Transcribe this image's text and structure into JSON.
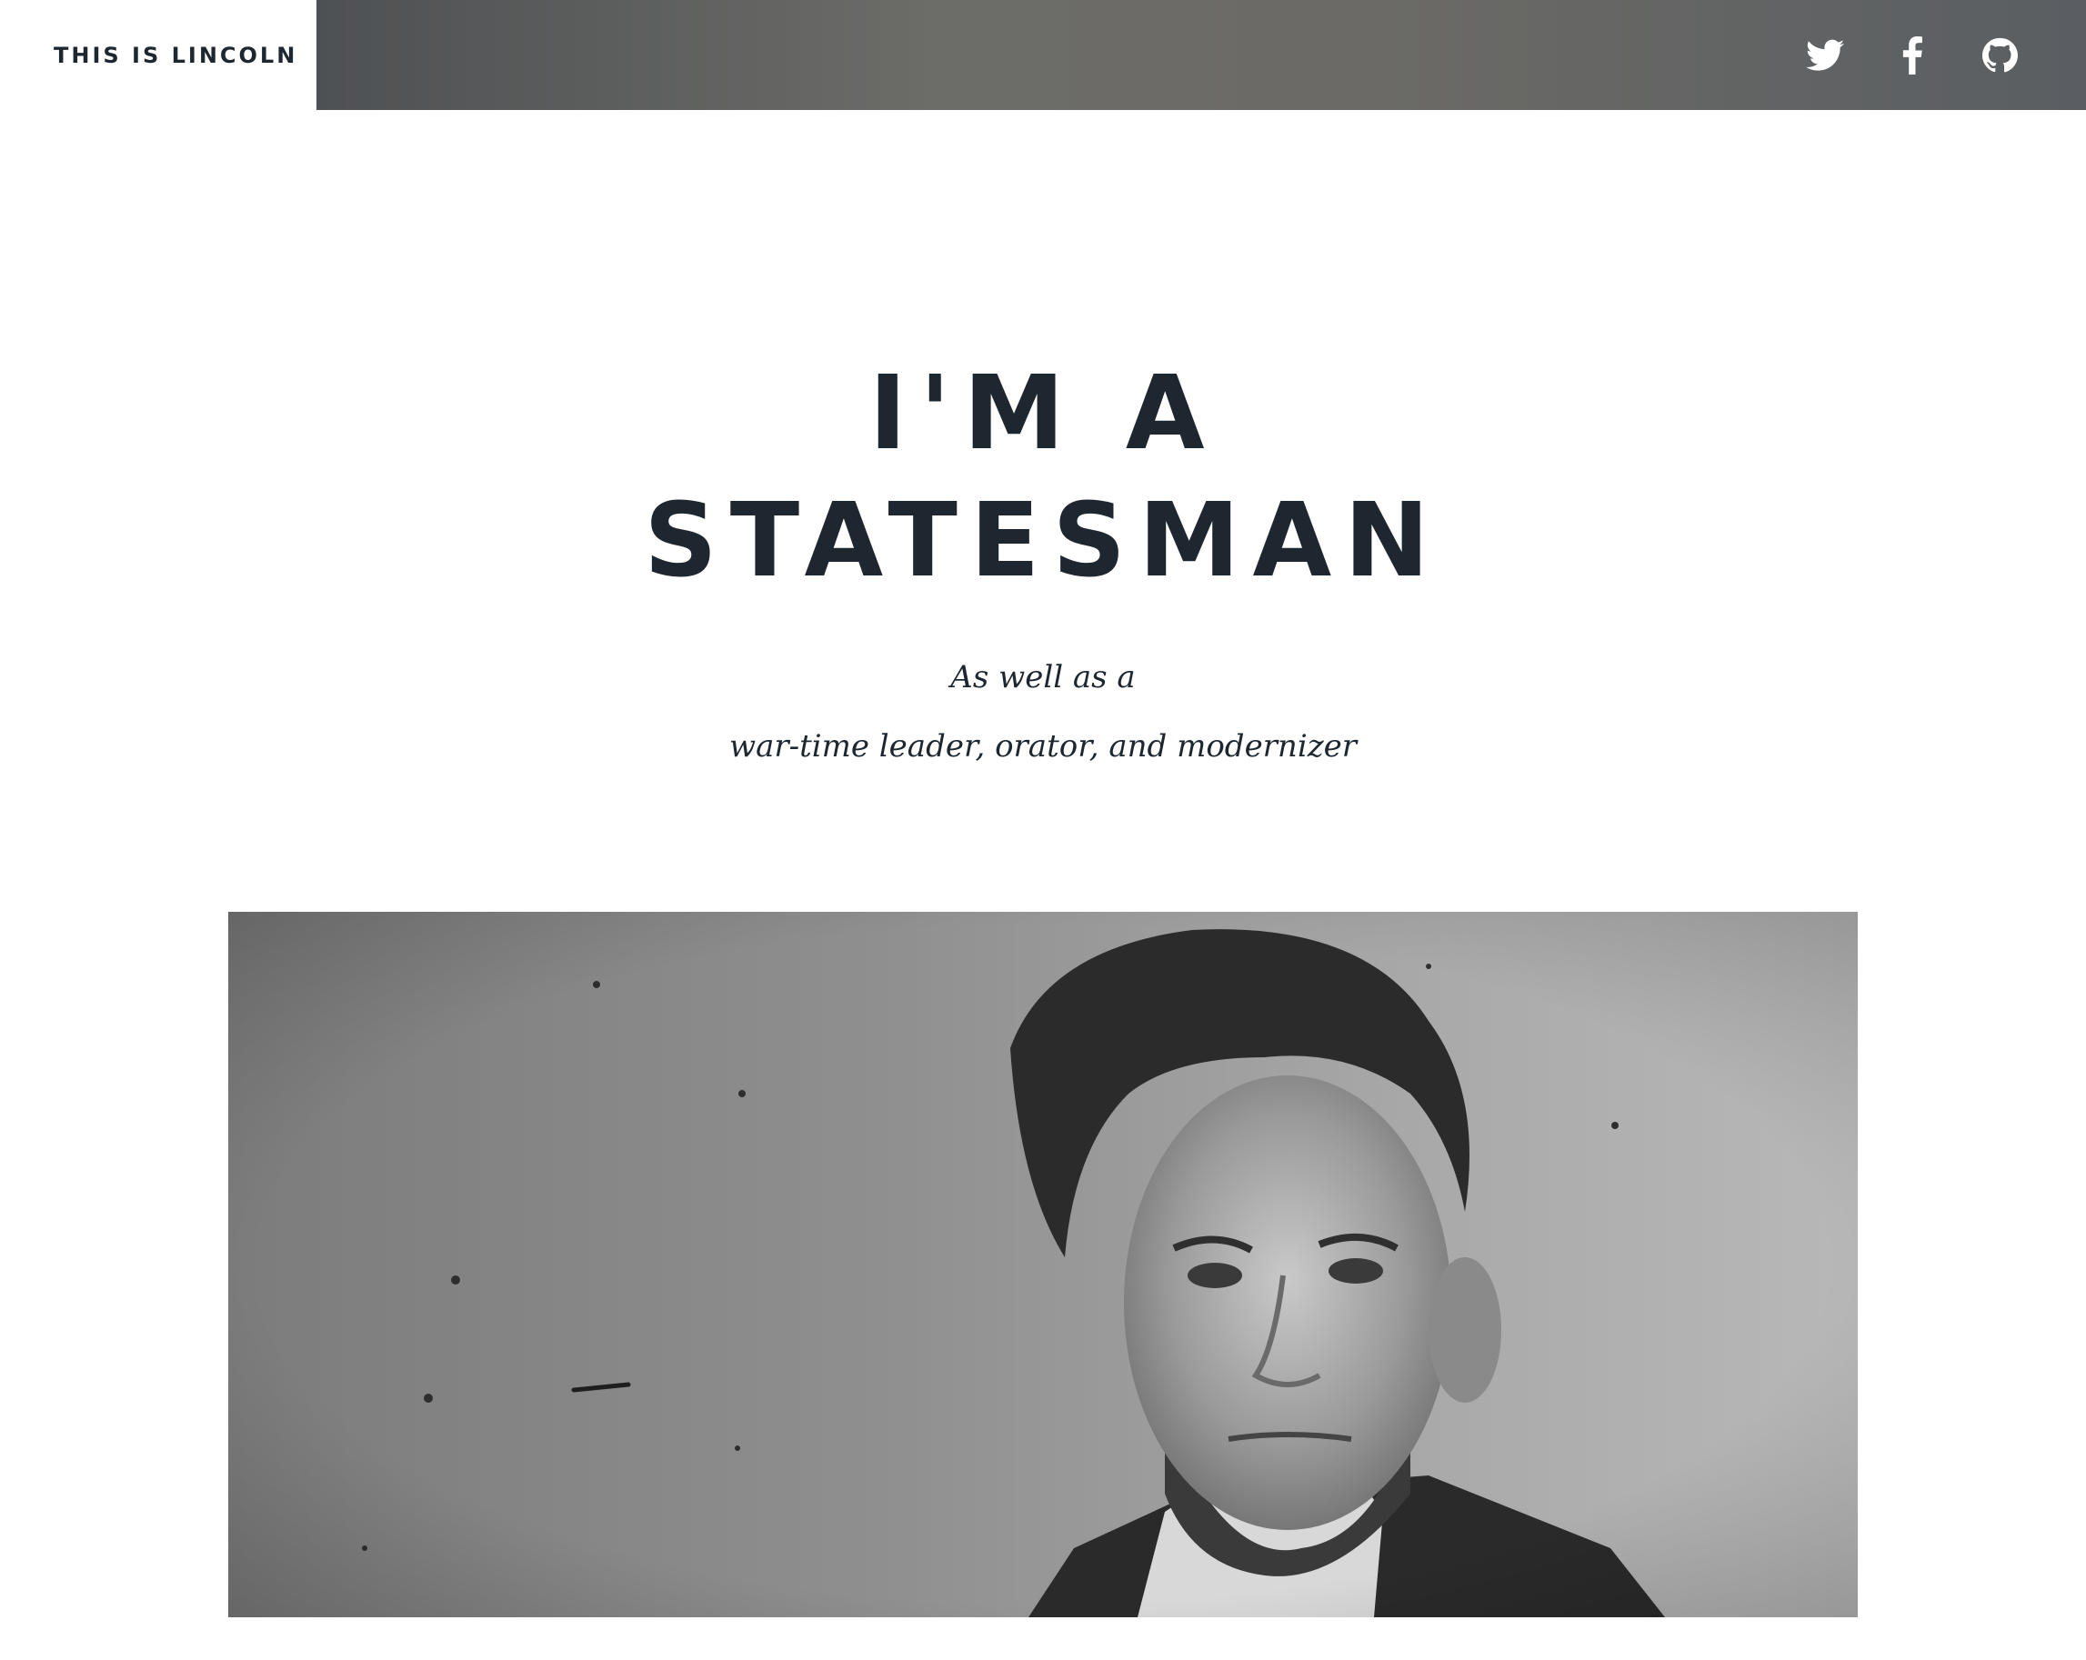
{
  "header": {
    "brand": "THIS IS LINCOLN",
    "social": [
      {
        "icon": "twitter-icon"
      },
      {
        "icon": "facebook-icon"
      },
      {
        "icon": "github-icon"
      }
    ]
  },
  "hero": {
    "headline_line1": "I'M A",
    "headline_line2": "STATESMAN",
    "subtitle_line1": "As well as a",
    "subtitle_line2": "war-time leader, orator, and modernizer"
  },
  "colors": {
    "text": "#1e2730",
    "background": "#ffffff"
  }
}
